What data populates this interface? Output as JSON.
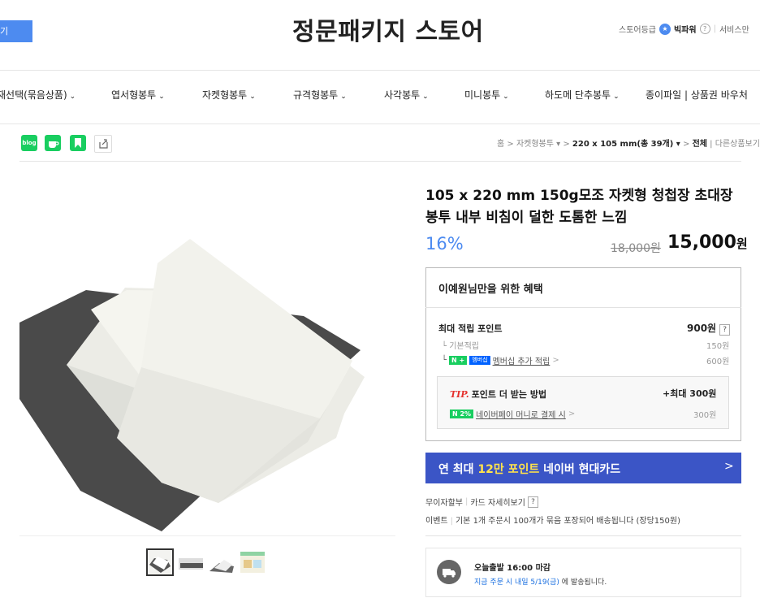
{
  "header": {
    "left_button_label": "기",
    "store_title": "정문패키지 스토어",
    "store_grade_label": "스토어등급",
    "store_grade_value": "빅파워",
    "help_q": "?",
    "service_label": "서비스만"
  },
  "nav": {
    "items": [
      {
        "label": "재선택(묶음상품)",
        "chevron": "⌄"
      },
      {
        "label": "엽서형봉투",
        "chevron": "⌄"
      },
      {
        "label": "자켓형봉투",
        "chevron": "⌄"
      },
      {
        "label": "규격형봉투",
        "chevron": "⌄"
      },
      {
        "label": "사각봉투",
        "chevron": "⌄"
      },
      {
        "label": "미니봉투",
        "chevron": "⌄"
      },
      {
        "label": "하도메 단추봉투",
        "chevron": "⌄"
      },
      {
        "label": "종이파일 | 상품권 바우처",
        "chevron": ""
      }
    ]
  },
  "sns": {
    "blog_label": "blog",
    "icons": [
      "blog-icon",
      "cafe-icon",
      "bookmark-icon",
      "share-icon"
    ]
  },
  "breadcrumb": {
    "home": "홈",
    "cat1": "자켓형봉투 ▾",
    "cat2": "220 x 105 mm(총 39개) ▾",
    "cat3": "전체",
    "other": "다른상품보기"
  },
  "product": {
    "title": "105 x 220 mm 150g모조 자켓형 청첩장 초대장 봉투 내부 비침이 덜한 도톰한 느낌",
    "discount": "16%",
    "original_price": "18,000원",
    "sale_price": "15,000",
    "sale_unit": "원"
  },
  "benefit": {
    "heading": "이예원님만을 위한 혜택",
    "max_point_label": "최대 적립 포인트",
    "max_point_value": "900원",
    "help_q": "?",
    "basic_label": "기본적립",
    "basic_value": "150원",
    "n_badge": "N",
    "plus_badge": "+",
    "membership_badge": "멤버십",
    "membership_link": "멤버십 추가 적립",
    "link_arrow": ">",
    "membership_value": "600원",
    "tip_prefix": "TIP.",
    "tip_label": "포인트 더 받는 방법",
    "tip_value": "+최대 300원",
    "tip_badge": "N 2%",
    "tip_link": "네이버페이 머니로 결제 시",
    "tip_sub_value": "300원"
  },
  "card_banner": {
    "prefix": "연 최대 ",
    "highlight": "12만 포인트",
    "suffix": " 네이버 현대카드",
    "arrow": ">"
  },
  "payment": {
    "installment": "무이자할부",
    "card_detail": "카드 자세히보기",
    "help_q": "?"
  },
  "event": {
    "label": "이벤트",
    "text": "기본 1개 주문시 100개가 묶음 포장되어 배송됩니다 (장당150원)"
  },
  "shipping": {
    "title": "오늘출발 16:00 마감",
    "sub_highlight": "지금 주문 시 내일 5/19(금)",
    "sub_suffix": " 에 발송됩니다."
  },
  "colors": {
    "accent": "#4d8bf0",
    "naver_green": "#19ce60",
    "card_banner": "#3b55c6",
    "card_highlight": "#ffe34c",
    "tip_red": "#e5302c"
  }
}
